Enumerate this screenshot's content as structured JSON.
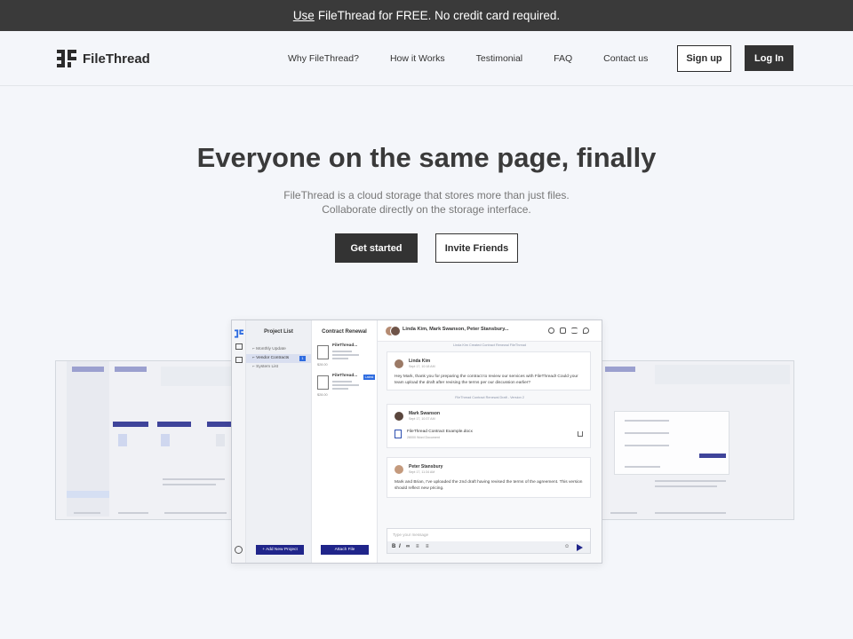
{
  "promo": {
    "link": "Use",
    "text": "FileThread for FREE. No credit card required."
  },
  "brand": {
    "name": "FileThread"
  },
  "nav": {
    "links": [
      "Why FileThread?",
      "How it Works",
      "Testimonial",
      "FAQ",
      "Contact us"
    ],
    "signup": "Sign up",
    "login": "Log In"
  },
  "hero": {
    "title": "Everyone on the same page, finally",
    "subtitle_line1": "FileThread is a cloud storage that stores more than just files.",
    "subtitle_line2": "Collaborate directly on the storage interface.",
    "primary_cta": "Get started",
    "secondary_cta": "Invite Friends"
  },
  "app": {
    "project_list": {
      "title": "Project List",
      "items": [
        "Monthly Update",
        "Vendor Contracts",
        "System List"
      ],
      "selected_count": "1",
      "add_button": "Add New Project"
    },
    "files": {
      "title": "Contract Renewal",
      "file1_name": "FileThread...",
      "file1_date": "$28.00",
      "file2_name": "FileThread...",
      "file2_badge": "Latest",
      "file2_date": "$28.00",
      "attach_button": "Attach File"
    },
    "chat": {
      "participants": "Linda Kim, Mark Swanson, Peter Stansbury...",
      "system1": "Linda Kim Created Contract Renewal FileThread",
      "msg1_name": "Linda Kim",
      "msg1_time": "Sept 17, 10:18 AM",
      "msg1_text": "Hey Mark, thank you for preparing the contract to review our services with FileThread! Could your team upload the draft after revising the terms per our discussion earlier?",
      "system2": "FileThread Contract Renewal Draft - Version 2",
      "msg2_name": "Mark Swanson",
      "msg2_time": "Sept 17, 10:37 AM",
      "msg2_file": "FileThread Contract Example.docx",
      "msg2_file_sub": "28000 Word Document",
      "msg3_name": "Peter Stansbury",
      "msg3_time": "Sept 17, 11:34 AM",
      "msg3_text": "Mark and Brian, I've uploaded the 2nd draft having revised the terms of the agreement. This version should reflect new pricing.",
      "input_placeholder": "Type your message"
    }
  },
  "icons": [
    "filethread-logo-icon",
    "search-icon",
    "people-icon",
    "menu-icon",
    "back-icon",
    "send-icon",
    "settings-icon",
    "document-icon",
    "download-icon"
  ]
}
